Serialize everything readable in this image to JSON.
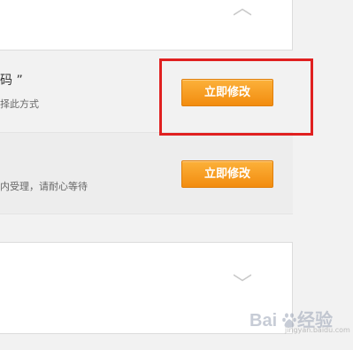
{
  "top_panel": {
    "chevron_glyph": "︿"
  },
  "rows": [
    {
      "title": "码 ”",
      "description": "择此方式",
      "button_label": "立即修改"
    },
    {
      "title": "",
      "description": "内受理，请耐心等待",
      "button_label": "立即修改"
    }
  ],
  "bottom_panel": {
    "chevron_glyph": "﹀"
  },
  "watermark": {
    "brand": "Baidu",
    "suffix": "经验",
    "url": "jingyan.baidu.com"
  },
  "colors": {
    "button": "#f5981f",
    "highlight": "#e02020",
    "background": "#f2f2f2"
  }
}
